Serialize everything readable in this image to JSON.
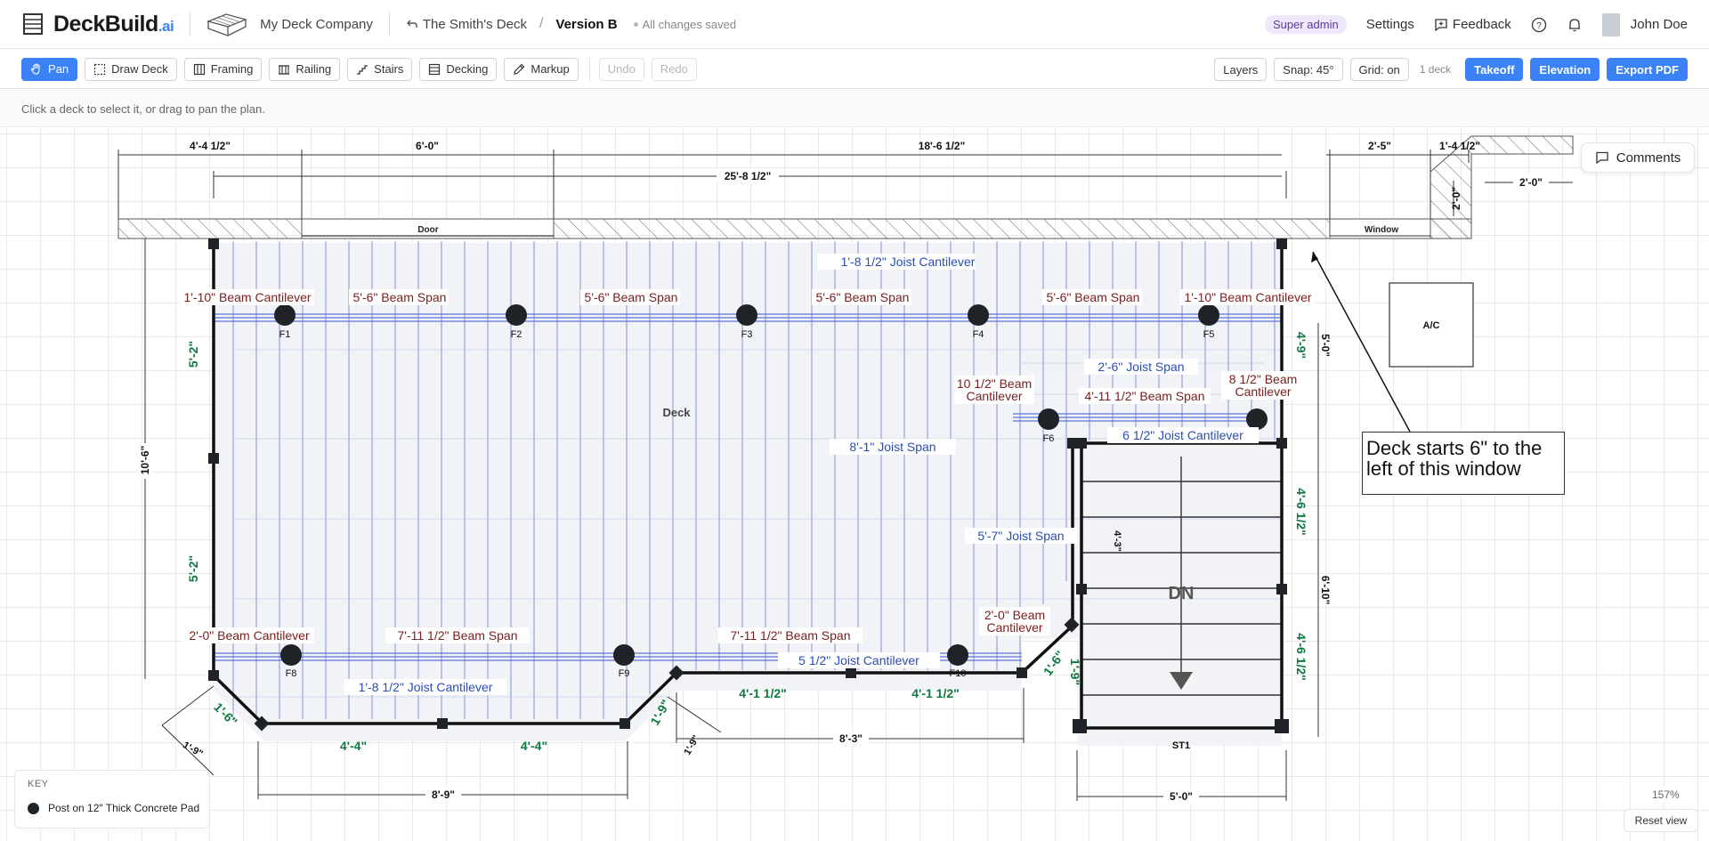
{
  "header": {
    "brand": "DeckBuild",
    "brand_suffix": ".ai",
    "company": "My Deck Company",
    "project": "The Smith's Deck",
    "version": "Version B",
    "save_status": "All changes saved",
    "role_badge": "Super admin",
    "settings": "Settings",
    "feedback": "Feedback",
    "user": "John Doe"
  },
  "toolbar": {
    "tools": [
      {
        "label": "Pan",
        "icon": "hand-icon",
        "active": true
      },
      {
        "label": "Draw Deck",
        "icon": "dashed-rect-icon"
      },
      {
        "label": "Framing",
        "icon": "framing-icon"
      },
      {
        "label": "Railing",
        "icon": "railing-icon"
      },
      {
        "label": "Stairs",
        "icon": "stairs-icon"
      },
      {
        "label": "Decking",
        "icon": "decking-icon"
      },
      {
        "label": "Markup",
        "icon": "pencil-icon"
      }
    ],
    "undo": "Undo",
    "redo": "Redo",
    "layers": "Layers",
    "snap": "Snap: 45°",
    "grid": "Grid: on",
    "deck_count": "1 deck",
    "takeoff": "Takeoff",
    "elevation": "Elevation",
    "export": "Export PDF"
  },
  "hint": "Click a deck to select it, or drag to pan the plan.",
  "canvas": {
    "comments": "Comments",
    "zoom": "157%",
    "reset_view": "Reset view",
    "key_title": "KEY",
    "key_item": "Post on 12\" Thick Concrete Pad",
    "note": "Deck starts 6\" to the left of this window"
  },
  "plan": {
    "top_dims": [
      "4'-4 1/2\"",
      "6'-0\"",
      "18'-6 1/2\"",
      "2'-5\"",
      "1'-4 1/2\""
    ],
    "overall_dim": "25'-8 1/2\"",
    "side_dim_right": "2'-0\"",
    "side_dim_vertical": "2'-0\"",
    "door": "Door",
    "window": "Window",
    "ac": "A/C",
    "deck_label": "Deck",
    "stair_dn": "DN",
    "stair_id": "ST1",
    "left_dim": "10'-6\"",
    "left_green": [
      "5'-2\"",
      "5'-2\""
    ],
    "right_green": [
      "4'-9\"",
      "4'-6 1/2\"",
      "4'-6 1/2\""
    ],
    "right_black": [
      "5'-0\"",
      "6'-10\""
    ],
    "stair_inner_dim": "4'-3\"",
    "beam_labels_top": [
      "1'-10\" Beam Cantilever",
      "5'-6\" Beam Span",
      "5'-6\" Beam Span",
      "5'-6\" Beam Span",
      "5'-6\" Beam Span",
      "1'-10\" Beam Cantilever"
    ],
    "footings_top": [
      "F1",
      "F2",
      "F3",
      "F4",
      "F5"
    ],
    "footing_f6": "F6",
    "footings_bottom": [
      "F8",
      "F9",
      "F10"
    ],
    "joist_cantilever_top": "1'-8 1/2\" Joist Cantilever",
    "joist_span_25": "2'-6\" Joist Span",
    "beam_1012": "10 1/2\" Beam",
    "beam_812": "8 1/2\" Beam",
    "cantilever_word": "Cantilever",
    "beam_4_11": "4'-11 1/2\" Beam Span",
    "joist_612": "6 1/2\" Joist Cantilever",
    "joist_81": "8'-1\" Joist Span",
    "joist_57": "5'-7\" Joist Span",
    "beam_20": "2'-0\" Beam",
    "beam_labels_bottom": [
      "2'-0\" Beam Cantilever",
      "7'-11 1/2\" Beam Span",
      "7'-11 1/2\" Beam Span"
    ],
    "joist_512": "5 1/2\" Joist Cantilever",
    "joist_cantilever_bottom": "1'-8 1/2\" Joist Cantilever",
    "bottom_green": [
      "4'-4\"",
      "4'-4\"",
      "4'-1 1/2\"",
      "4'-1 1/2\""
    ],
    "diag_green": [
      "1'-6\"",
      "1'-9\"",
      "1'-6\"",
      "1'-9\""
    ],
    "diag_black": [
      "1'-9\"",
      "1'-9\""
    ],
    "bottom_dims": [
      "8'-9\"",
      "8'-3\"",
      "5'-0\""
    ]
  }
}
